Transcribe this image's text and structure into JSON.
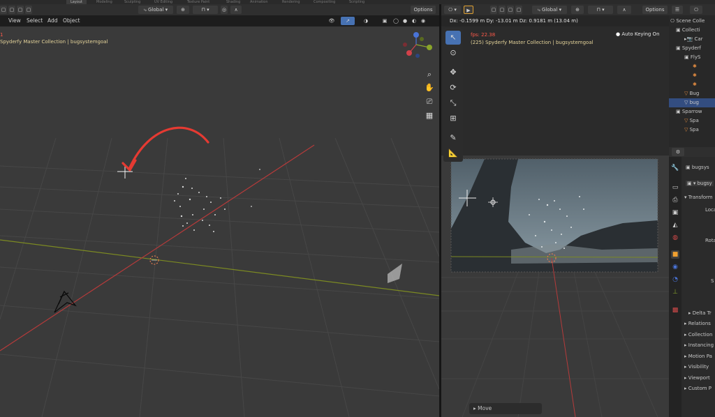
{
  "workspace_tabs": [
    "Layout",
    "Modeling",
    "Sculpting",
    "UV Editing",
    "Texture Paint",
    "Shading",
    "Animation",
    "Rendering",
    "Compositing",
    "Scripting"
  ],
  "left_header": {
    "menus": [
      "View",
      "Select",
      "Add",
      "Object"
    ],
    "transform_orientation": "Global",
    "options_label": "Options"
  },
  "left_viewport": {
    "overlay_text": "Spyderfy Master Collection | bugsystemgoal",
    "fps_fragment": "1"
  },
  "right_header": {
    "transform_orientation": "Global",
    "options_label": "Options",
    "delta_readout": "Dx: -0.1599 m   Dy: -13.01 m   Dz: 0.9181 m (13.04 m)"
  },
  "right_viewport": {
    "fps_text": "fps: 22.38",
    "collection_text": "(225) Spyderfy Master Collection | bugsystemgoal",
    "auto_keying": "Auto Keying On",
    "last_operator": "Move"
  },
  "outliner": {
    "items": [
      {
        "label": "Scene Colle",
        "indent": 2
      },
      {
        "label": "Collecti",
        "indent": 10
      },
      {
        "label": "Car",
        "indent": 22
      },
      {
        "label": "Spyderf",
        "indent": 10
      },
      {
        "label": "FlyS",
        "indent": 22
      },
      {
        "label": "",
        "indent": 34
      },
      {
        "label": "",
        "indent": 34
      },
      {
        "label": "",
        "indent": 34
      },
      {
        "label": "Bug",
        "indent": 22
      },
      {
        "label": "bug",
        "indent": 22,
        "selected": true
      },
      {
        "label": "Sparrow",
        "indent": 10
      },
      {
        "label": "Spa",
        "indent": 22
      },
      {
        "label": "Spa",
        "indent": 22
      }
    ]
  },
  "properties": {
    "object_name": "bugsys",
    "data_name": "bugsy",
    "rows": [
      "Transform",
      "Loca",
      "Rota",
      "S",
      "Delta Tr",
      "Relations",
      "Collection",
      "Instancing",
      "Motion Pa",
      "Visibility",
      "Viewport",
      "Custom P"
    ]
  },
  "colors": {
    "accent": "#4772b3",
    "annotation_arrow": "#e53a32",
    "x_axis": "#b53a3a",
    "y_axis": "#7c8a22"
  }
}
